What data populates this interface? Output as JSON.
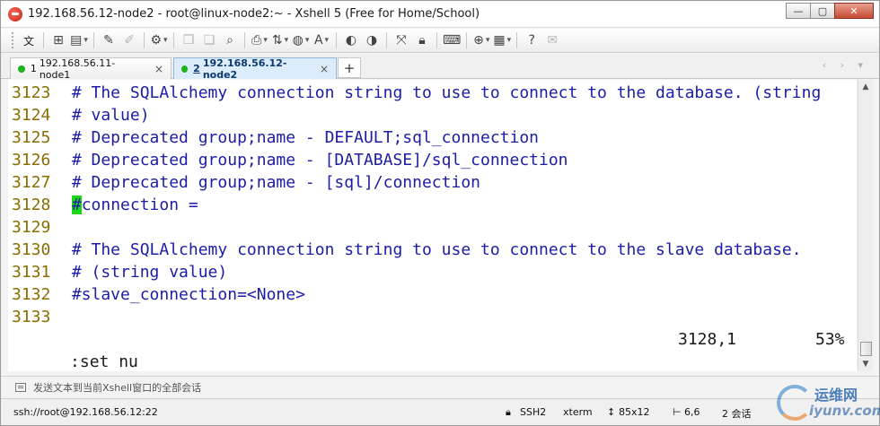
{
  "window": {
    "title": "192.168.56.12-node2 - root@linux-node2:~ - Xshell 5 (Free for Home/School)",
    "controls": {
      "minimize": "—",
      "maximize": "▢",
      "close": "✕"
    }
  },
  "toolbar": {
    "language_label": "文"
  },
  "tabs": [
    {
      "number": "1",
      "label": "192.168.56.11-node1",
      "close": "×",
      "active": false
    },
    {
      "number": "2",
      "label": "192.168.56.12-node2",
      "close": "×",
      "active": true
    }
  ],
  "tab_add": "+",
  "tab_nav": "‹ › ▾",
  "terminal": {
    "lines": [
      {
        "num": "3123",
        "text": " # The SQLAlchemy connection string to use to connect to the database. (string"
      },
      {
        "num": "3124",
        "text": " # value)"
      },
      {
        "num": "3125",
        "text": " # Deprecated group;name - DEFAULT;sql_connection"
      },
      {
        "num": "3126",
        "text": " # Deprecated group;name - [DATABASE]/sql_connection"
      },
      {
        "num": "3127",
        "text": " # Deprecated group;name - [sql]/connection"
      },
      {
        "num": "3128",
        "cursor_char": "#",
        "text": "connection ="
      },
      {
        "num": "3129",
        "text": ""
      },
      {
        "num": "3130",
        "text": " # The SQLAlchemy connection string to use to connect to the slave database."
      },
      {
        "num": "3131",
        "text": " # (string value)"
      },
      {
        "num": "3132",
        "text": " #slave_connection=<None>"
      },
      {
        "num": "3133",
        "text": ""
      }
    ],
    "command": ":set nu",
    "position": "3128,1",
    "percent": "53%"
  },
  "compose": {
    "placeholder": "发送文本到当前Xshell窗口的全部会话"
  },
  "statusbar": {
    "connection": "ssh://root@192.168.56.12:22",
    "protocol": "SSH2",
    "terminal_type": "xterm",
    "size": "85x12",
    "cursor": "6,6",
    "sessions": "2 会话"
  },
  "watermark": {
    "line1": "运维网",
    "line2": "iyunv.com"
  }
}
